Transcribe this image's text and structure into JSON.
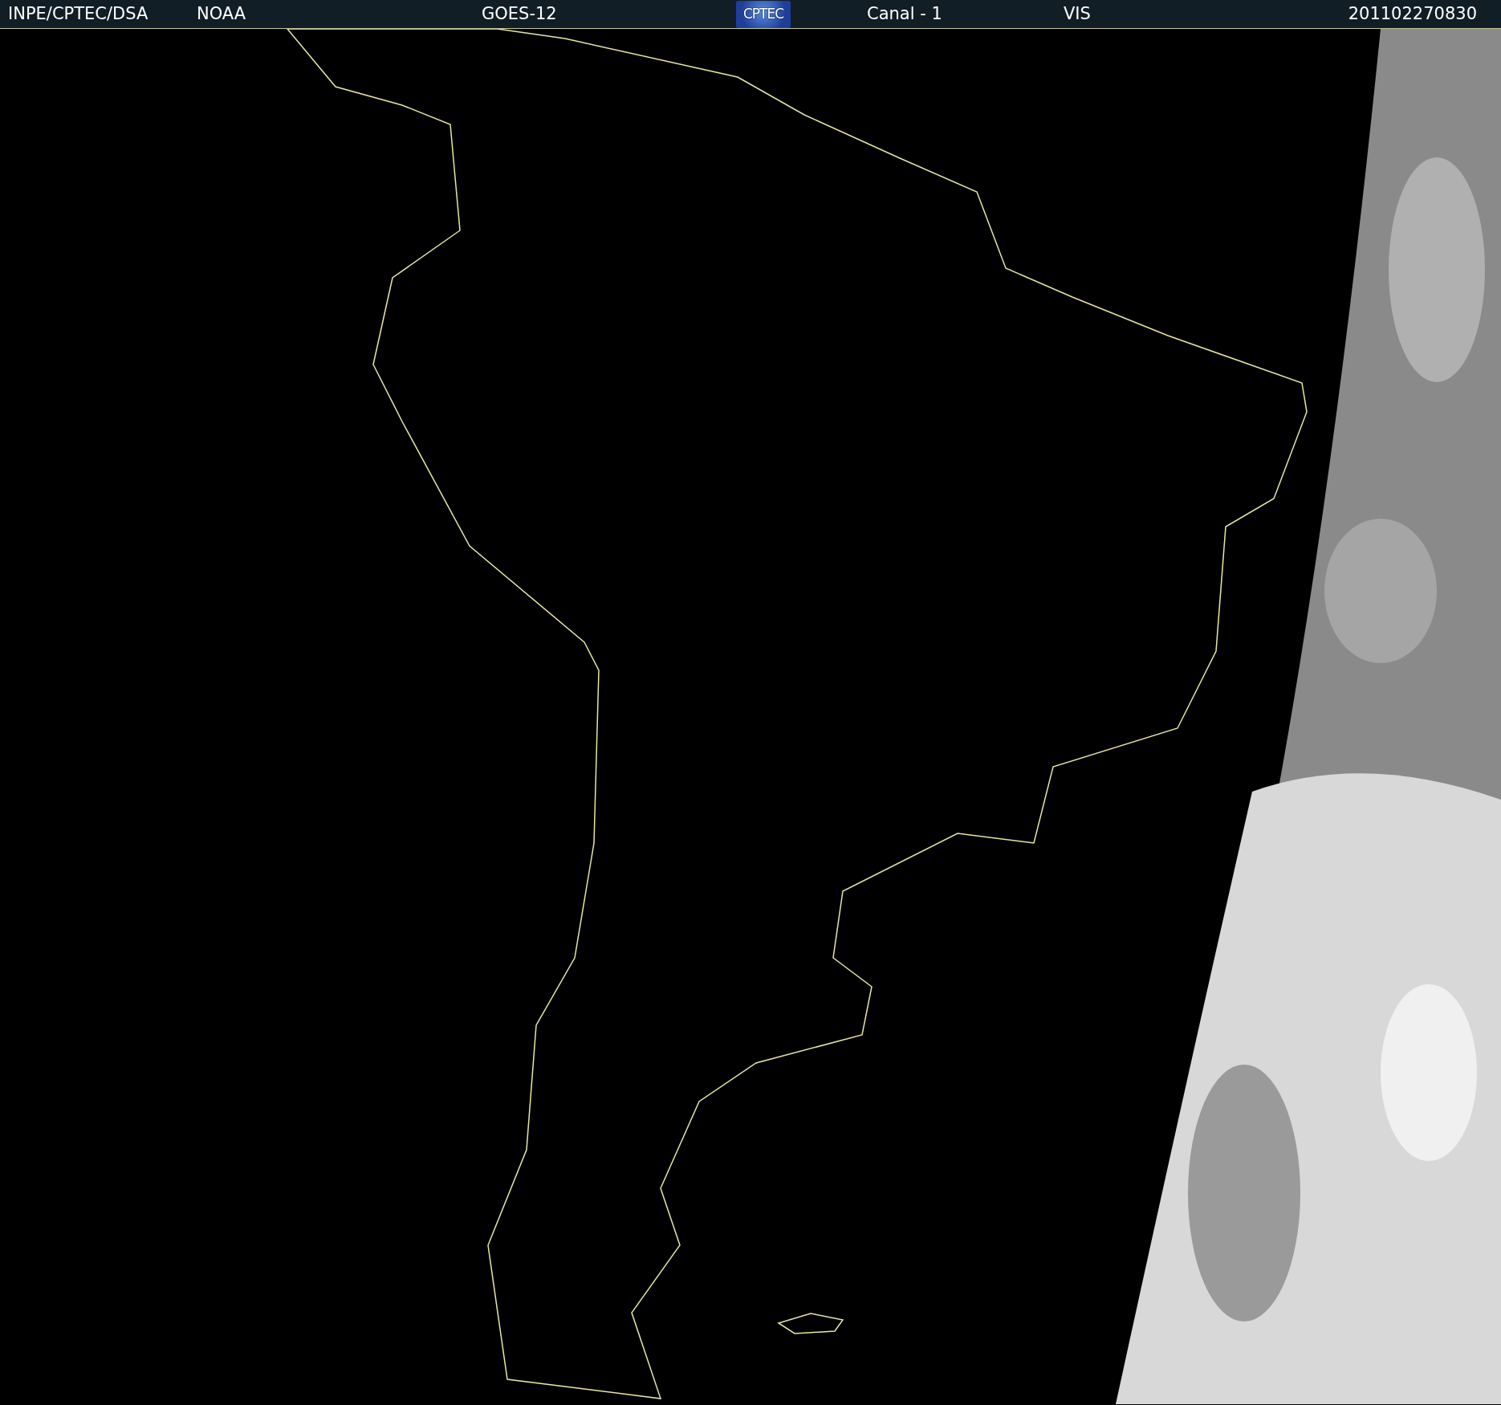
{
  "header": {
    "source": "INPE/CPTEC/DSA",
    "agency": "NOAA",
    "satellite": "GOES-12",
    "logo_text": "CPTEC",
    "channel": "Canal - 1",
    "band": "VIS",
    "timestamp": "201102270830"
  }
}
